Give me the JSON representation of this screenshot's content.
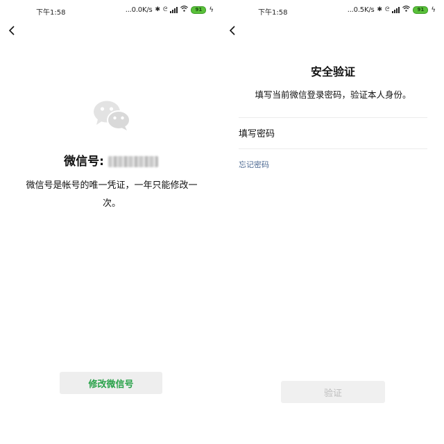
{
  "status_left": {
    "time": "下午1:58",
    "net_speed": "...0.0K/s",
    "battery": "91"
  },
  "status_right": {
    "time": "下午1:58",
    "net_speed": "...0.5K/s",
    "battery": "91"
  },
  "left_screen": {
    "wechat_id_label": "微信号:",
    "description": "微信号是帐号的唯一凭证，一年只能修改一次。",
    "modify_button": "修改微信号"
  },
  "right_screen": {
    "title": "安全验证",
    "subtitle": "填写当前微信登录密码，验证本人身份。",
    "password_placeholder": "填写密码",
    "forgot_password": "忘记密码",
    "verify_button": "验证"
  },
  "colors": {
    "accent_green": "#2aa24a",
    "link_blue": "#4e6a93",
    "battery_green": "#5ac13a"
  },
  "icons": [
    "back-chevron-icon",
    "bluetooth-icon",
    "alarm-icon",
    "signal-icon",
    "wifi-icon",
    "battery-icon",
    "charging-icon",
    "wechat-logo-icon"
  ]
}
